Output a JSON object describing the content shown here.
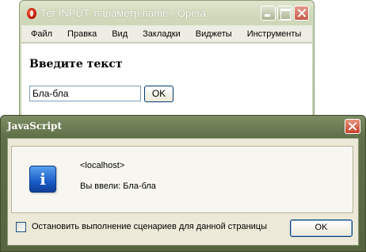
{
  "browser": {
    "title": "Тег INPUT, параметр name - Opera",
    "menu": [
      "Файл",
      "Правка",
      "Вид",
      "Закладки",
      "Виджеты",
      "Инструменты"
    ],
    "page": {
      "heading": "Введите текст",
      "input_value": "Бла-бла",
      "ok_label": "OK"
    }
  },
  "dialog": {
    "title": "JavaScript",
    "host": "<localhost>",
    "message": "Вы ввели: Бла-бла",
    "checkbox_label": "Остановить выполнение сценариев для данной страницы",
    "checkbox_checked": false,
    "ok_label": "OK"
  },
  "icons": {
    "browser_logo": "opera-logo-icon",
    "dialog_icon": "info-icon",
    "info_glyph": "i"
  }
}
